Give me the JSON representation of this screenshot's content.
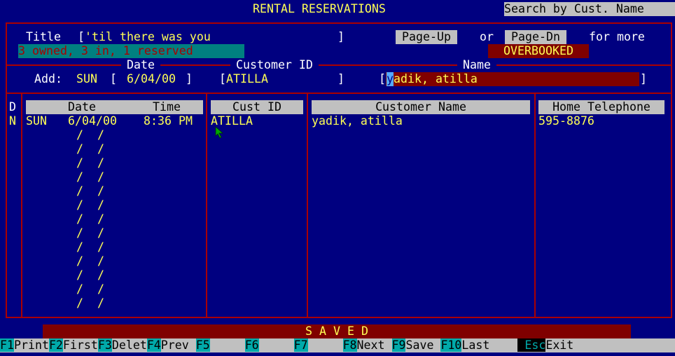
{
  "header": {
    "title": "RENTAL RESERVATIONS",
    "search_mode": "Search by Cust. Name"
  },
  "record": {
    "title_label": "Title",
    "title_open": "[",
    "title_value": "'til there was you",
    "title_close": "]",
    "inventory_status": "3 owned, 3 in, 1 reserved",
    "page_up": "Page-Up",
    "or_text": "or",
    "page_dn": "Page-Dn",
    "for_more": "for more",
    "overbooked": "OVERBOOKED"
  },
  "add_row": {
    "date_header": "Date",
    "custid_header": "Customer ID",
    "name_header": "Name",
    "add_label": "Add:",
    "day": "SUN",
    "date_open": "[",
    "date_value": "6/04/00",
    "date_close": "]",
    "custid_open": "[",
    "custid_value": "ATILLA",
    "custid_close": "]",
    "name_open": "[",
    "name_cursor_char": "y",
    "name_value_rest": "adik, atilla",
    "name_close": "]"
  },
  "table": {
    "col_d": "D",
    "col_date": "Date",
    "col_time": "Time",
    "col_custid": "Cust ID",
    "col_name": "Customer Name",
    "col_phone": "Home Telephone",
    "rows": [
      {
        "d": "N",
        "day": "SUN",
        "date": "6/04/00",
        "time": "8:36 PM",
        "custid": "ATILLA",
        "name": "yadik, atilla",
        "phone": "595-8876"
      }
    ],
    "empty_date": "/  /"
  },
  "status": {
    "message": "S A V E D"
  },
  "fkeys": [
    {
      "key": "F1",
      "label": "Print"
    },
    {
      "key": "F2",
      "label": "First"
    },
    {
      "key": "F3",
      "label": "Delet"
    },
    {
      "key": "F4",
      "label": "Prev "
    },
    {
      "key": "F5",
      "label": "     "
    },
    {
      "key": "F6",
      "label": "     "
    },
    {
      "key": "F7",
      "label": "     "
    },
    {
      "key": "F8",
      "label": "Next "
    },
    {
      "key": "F9",
      "label": "Save "
    },
    {
      "key": "F10",
      "label": "Last    "
    },
    {
      "key": "Esc",
      "label": "Exit"
    }
  ],
  "colors": {
    "background": "#000080",
    "border": "#aa0000",
    "highlight": "#ffff55",
    "field_bg": "#800000",
    "status_bg": "#008080",
    "fkey_bg": "#00aaaa",
    "label_bg": "#c0c0c0"
  }
}
